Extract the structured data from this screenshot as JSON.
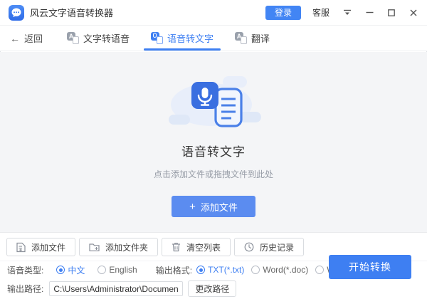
{
  "colors": {
    "primary": "#3e7ff2",
    "login_blue": "#4285f4",
    "add_button_blue": "#5b8cf0",
    "main_bg": "#f4f5f7"
  },
  "titlebar": {
    "app_title": "风云文字语音转换器",
    "login": "登录",
    "support": "客服"
  },
  "nav": {
    "back": "返回",
    "tabs": [
      {
        "label": "文字转语音",
        "active": false
      },
      {
        "label": "语音转文字",
        "active": true
      },
      {
        "label": "翻译",
        "active": false
      }
    ]
  },
  "main": {
    "title": "语音转文字",
    "hint": "点击添加文件或拖拽文件到此处",
    "add_button": "添加文件",
    "plus": "+"
  },
  "toolbar": {
    "buttons": [
      {
        "label": "添加文件",
        "icon": "file-plus-icon"
      },
      {
        "label": "添加文件夹",
        "icon": "folder-plus-icon"
      },
      {
        "label": "清空列表",
        "icon": "trash-icon"
      },
      {
        "label": "历史记录",
        "icon": "clock-icon"
      }
    ]
  },
  "settings": {
    "voice_type_label": "语音类型:",
    "voice_options": [
      {
        "label": "中文",
        "selected": true
      },
      {
        "label": "English",
        "selected": false
      }
    ],
    "format_label": "输出格式:",
    "format_options": [
      {
        "label": "TXT(*.txt)",
        "selected": true
      },
      {
        "label": "Word(*.doc)",
        "selected": false
      },
      {
        "label": "Word(*.docx)",
        "selected": false
      }
    ]
  },
  "output": {
    "path_label": "输出路径:",
    "path_value": "C:\\Users\\Administrator\\Documents\\风云文",
    "change_button": "更改路径"
  },
  "convert_button": "开始转换"
}
